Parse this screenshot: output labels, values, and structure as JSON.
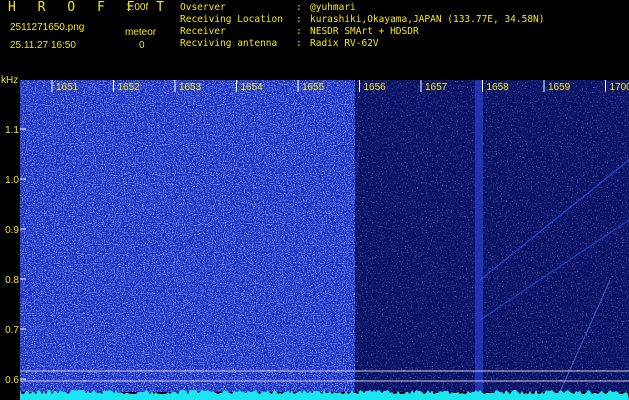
{
  "header": {
    "title": "H R O F F T",
    "version": "1.00f",
    "filename": "2511271650.png",
    "timestamp": "25.11.27 16:50",
    "meteor_label": "meteor",
    "meteor_count": "0",
    "info": [
      {
        "key": "Ovserver",
        "value": "@yuhmari"
      },
      {
        "key": "Receiving Location",
        "value": "kurashiki,Okayama,JAPAN (133.77E, 34.58N)"
      },
      {
        "key": "Receiver",
        "value": "NESDR SMArt + HDSDR"
      },
      {
        "key": "Recviving antenna",
        "value": "Radix RV-62V"
      }
    ]
  },
  "axis": {
    "y_unit": "kHz",
    "x_ticks": [
      "1651",
      "1652",
      "1653",
      "1654",
      "1655",
      "1656",
      "1657",
      "1658",
      "1659",
      "1700"
    ],
    "y_ticks": [
      "1.1",
      "1.0",
      "0.9",
      "0.8",
      "0.7",
      "0.6"
    ]
  },
  "colors": {
    "text": "#f2e81e",
    "background": "#000000",
    "spectrogram": "#1a2bbf",
    "baseline": "#19e6f0"
  }
}
